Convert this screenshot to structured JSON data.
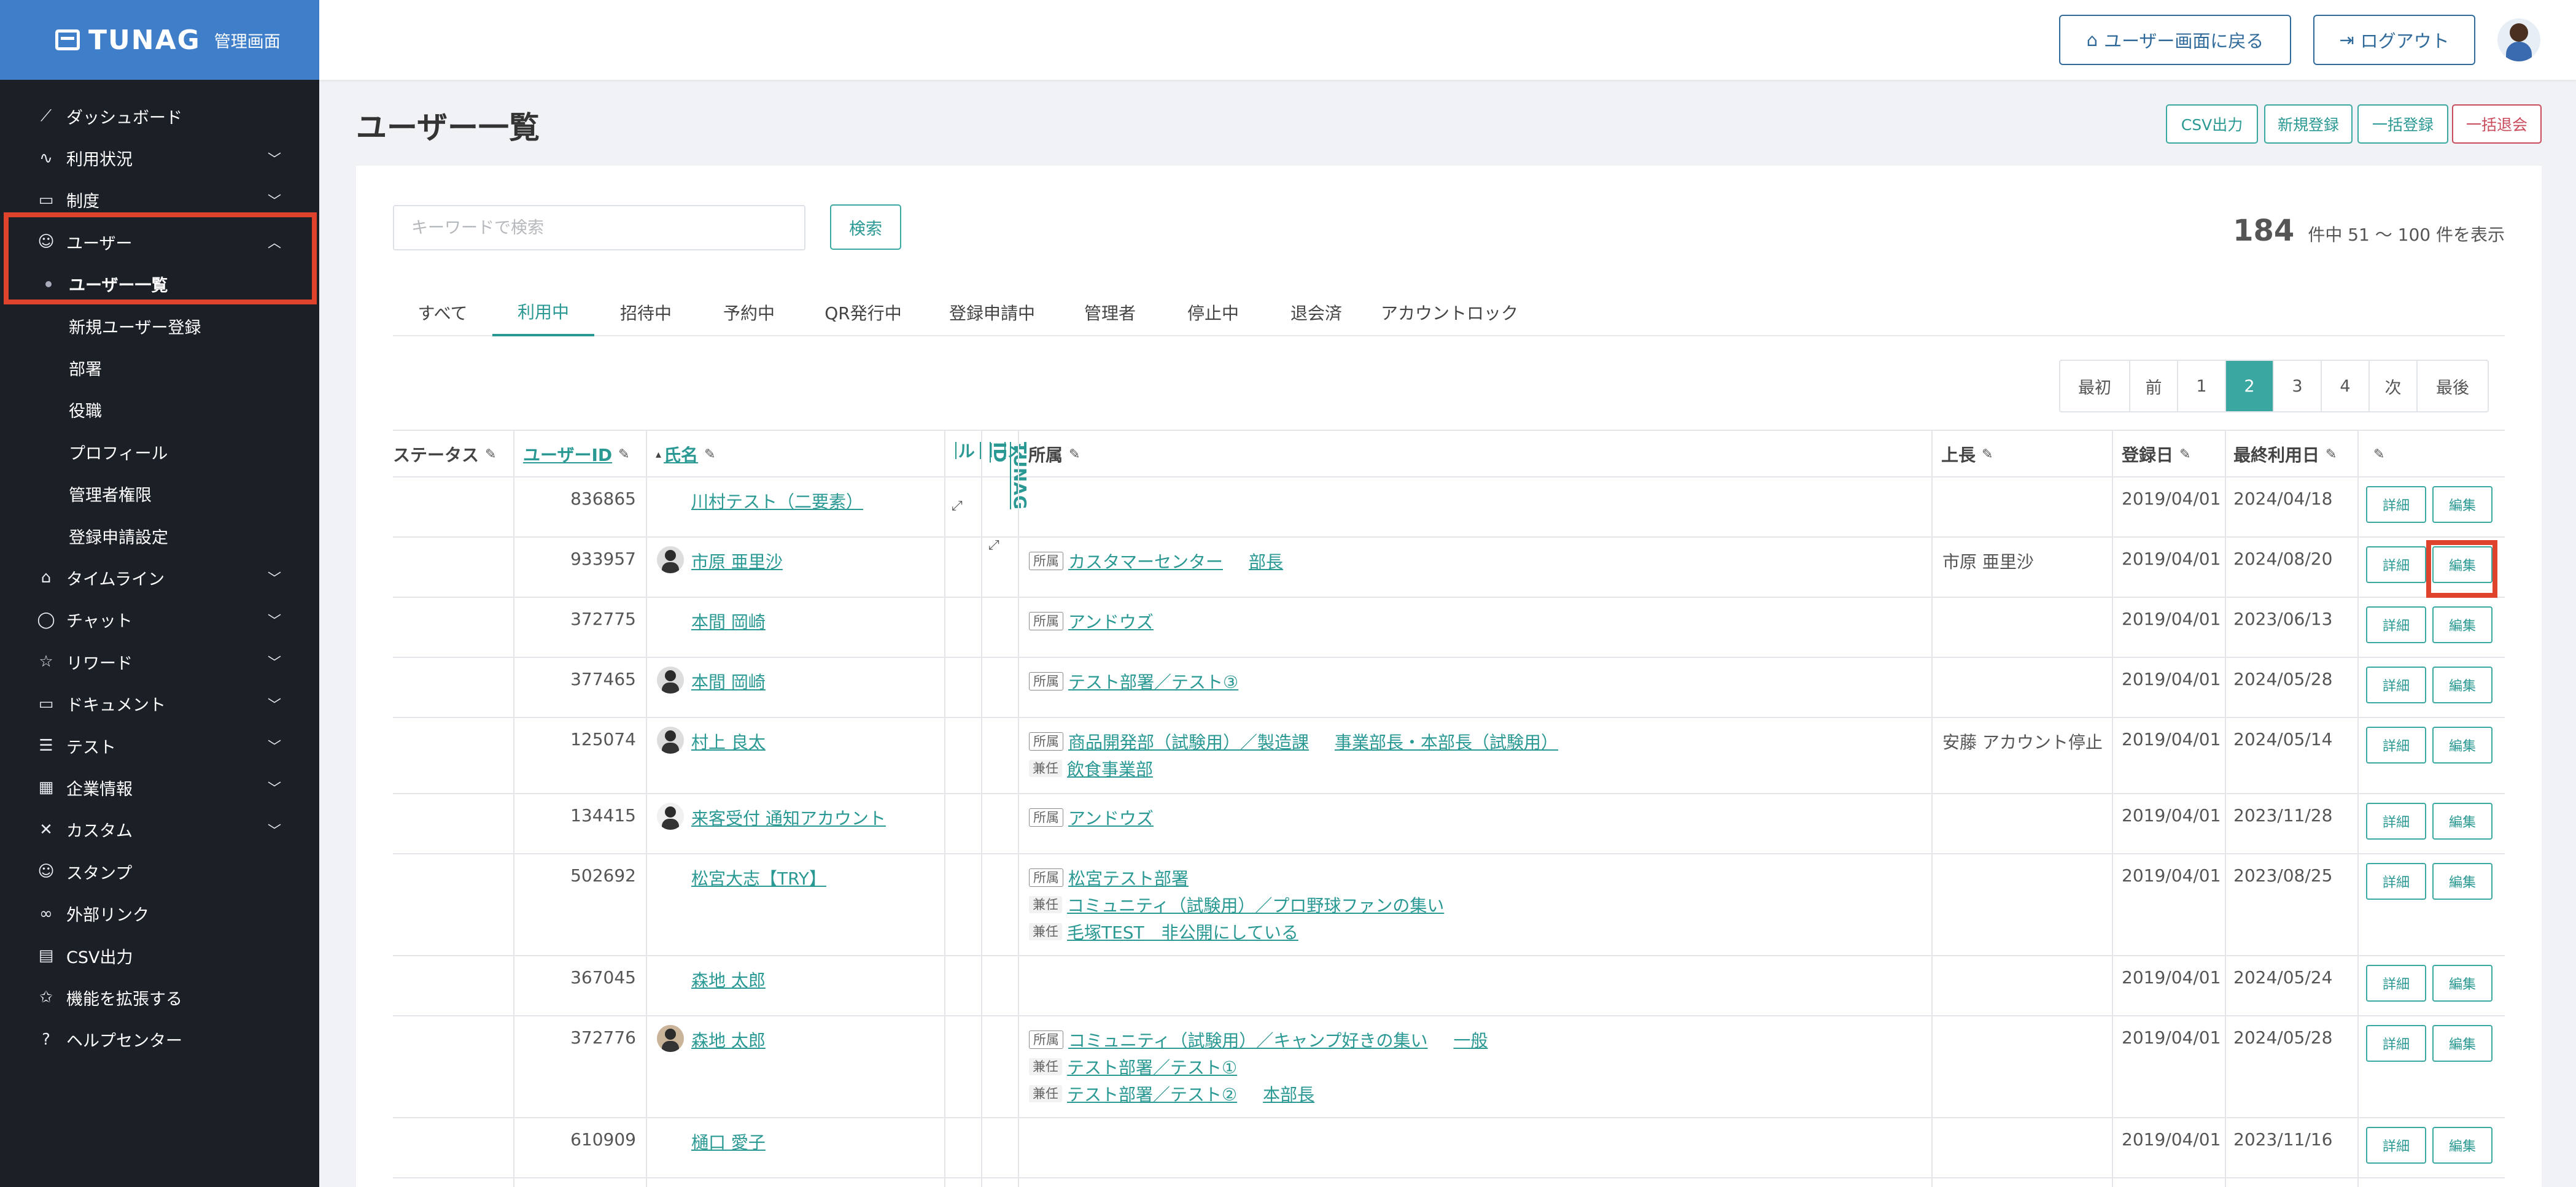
{
  "brand": {
    "name": "TUNAG",
    "sub": "管理画面"
  },
  "sidebar": {
    "items": [
      {
        "label": "ダッシュボード",
        "icon": "chart-icon",
        "chev": false
      },
      {
        "label": "利用状況",
        "icon": "pulse-icon",
        "chev": true
      },
      {
        "label": "制度",
        "icon": "book-icon",
        "chev": true
      },
      {
        "label": "ユーザー",
        "icon": "users-icon",
        "chev": true,
        "open": true
      },
      {
        "label": "タイムライン",
        "icon": "home-icon",
        "chev": true
      },
      {
        "label": "チャット",
        "icon": "chat-icon",
        "chev": true
      },
      {
        "label": "リワード",
        "icon": "star-icon",
        "chev": true
      },
      {
        "label": "ドキュメント",
        "icon": "folder-icon",
        "chev": true
      },
      {
        "label": "テスト",
        "icon": "test-icon",
        "chev": true
      },
      {
        "label": "企業情報",
        "icon": "building-icon",
        "chev": true
      },
      {
        "label": "カスタム",
        "icon": "tools-icon",
        "chev": true
      },
      {
        "label": "スタンプ",
        "icon": "smile-icon",
        "chev": false
      },
      {
        "label": "外部リンク",
        "icon": "link-icon",
        "chev": false
      },
      {
        "label": "CSV出力",
        "icon": "table-icon",
        "chev": false
      },
      {
        "label": "機能を拡張する",
        "icon": "star-plus-icon",
        "chev": false
      },
      {
        "label": "ヘルプセンター",
        "icon": "help-icon",
        "chev": false
      }
    ],
    "sub_items": [
      "ユーザー一覧",
      "新規ユーザー登録",
      "部署",
      "役職",
      "プロフィール",
      "管理者権限",
      "登録申請設定"
    ]
  },
  "header": {
    "back_label": "ユーザー画面に戻る",
    "logout_label": "ログアウト"
  },
  "page": {
    "title": "ユーザー一覧",
    "actions": [
      "CSV出力",
      "新規登録",
      "一括登録",
      "一括退会"
    ]
  },
  "search": {
    "placeholder": "キーワードで検索",
    "button": "検索"
  },
  "count": {
    "total": "184",
    "text": "件中 51 ～ 100 件を表示"
  },
  "tabs": [
    "すべて",
    "利用中",
    "招待中",
    "予約中",
    "QR発行中",
    "登録申請中",
    "管理者",
    "停止中",
    "退会済",
    "アカウントロック"
  ],
  "pager": [
    "最初",
    "前",
    "1",
    "2",
    "3",
    "4",
    "次",
    "最後"
  ],
  "table": {
    "headers": {
      "status": "ステータス",
      "user_id": "ユーザーID",
      "name": "氏名",
      "mail": "メール",
      "tunag_id": "TUNAG ID",
      "dept": "所属",
      "boss": "上長",
      "reg": "登録日",
      "last": "最終利用日"
    },
    "detail_label": "詳細",
    "edit_label": "編集",
    "rows": [
      {
        "id": "836865",
        "name": "川村テスト（二要素）",
        "boss": "",
        "reg": "2019/04/01",
        "last": "2024/04/18",
        "depts": []
      },
      {
        "id": "933957",
        "name": "市原 亜里沙",
        "boss": "市原 亜里沙",
        "reg": "2019/04/01",
        "last": "2024/08/20",
        "depts": [
          {
            "tag": "所属",
            "text": "カスタマーセンター",
            "role": "部長"
          }
        ]
      },
      {
        "id": "372775",
        "name": "本間 岡崎",
        "boss": "",
        "reg": "2019/04/01",
        "last": "2023/06/13",
        "depts": [
          {
            "tag": "所属",
            "text": "アンドウズ",
            "role": ""
          }
        ]
      },
      {
        "id": "377465",
        "name": "本間 岡崎",
        "boss": "",
        "reg": "2019/04/01",
        "last": "2024/05/28",
        "depts": [
          {
            "tag": "所属",
            "text": "テスト部署／テスト③",
            "role": ""
          }
        ]
      },
      {
        "id": "125074",
        "name": "村上 良太",
        "boss": "安藤 アカウント停止",
        "reg": "2019/04/01",
        "last": "2024/05/14",
        "depts": [
          {
            "tag": "所属",
            "text": "商品開発部（試験用）／製造課",
            "role": "事業部長・本部長（試験用）"
          },
          {
            "tag": "兼任",
            "text": "飲食事業部",
            "role": ""
          }
        ]
      },
      {
        "id": "134415",
        "name": "来客受付 通知アカウント",
        "boss": "",
        "reg": "2019/04/01",
        "last": "2023/11/28",
        "depts": [
          {
            "tag": "所属",
            "text": "アンドウズ",
            "role": ""
          }
        ]
      },
      {
        "id": "502692",
        "name": "松宮大志【TRY】",
        "boss": "",
        "reg": "2019/04/01",
        "last": "2023/08/25",
        "depts": [
          {
            "tag": "所属",
            "text": "松宮テスト部署",
            "role": ""
          },
          {
            "tag": "兼任",
            "text": "コミュニティ（試験用）／プロ野球ファンの集い",
            "role": ""
          },
          {
            "tag": "兼任",
            "text": "毛塚TEST　非公開にしている",
            "role": ""
          }
        ]
      },
      {
        "id": "367045",
        "name": "森地 太郎",
        "boss": "",
        "reg": "2019/04/01",
        "last": "2024/05/24",
        "depts": []
      },
      {
        "id": "372776",
        "name": "森地 太郎",
        "boss": "",
        "reg": "2019/04/01",
        "last": "2024/05/28",
        "depts": [
          {
            "tag": "所属",
            "text": "コミュニティ（試験用）／キャンプ好きの集い",
            "role": "一般"
          },
          {
            "tag": "兼任",
            "text": "テスト部署／テスト①",
            "role": ""
          },
          {
            "tag": "兼任",
            "text": "テスト部署／テスト②",
            "role": "本部長"
          }
        ]
      },
      {
        "id": "610909",
        "name": "樋口 愛子",
        "boss": "",
        "reg": "2019/04/01",
        "last": "2023/11/16",
        "depts": []
      }
    ]
  }
}
